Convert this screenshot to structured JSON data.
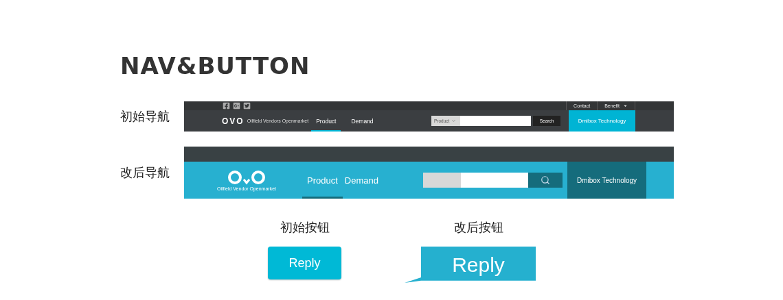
{
  "title": "NAV&BUTTON",
  "navs": [
    {
      "kind": "original",
      "label": "初始导航",
      "top_links": [
        {
          "label": "Contact",
          "dropdown": false
        },
        {
          "label": "Benefit",
          "dropdown": true
        }
      ],
      "logo": "OVO",
      "tagline": "Oilfield Vendors Openmarket",
      "items": [
        {
          "label": "Product",
          "selected": true
        },
        {
          "label": "Demand",
          "selected": false
        }
      ],
      "search": {
        "category": "Product",
        "button": "Search"
      },
      "account": "Dmibox Technology"
    },
    {
      "kind": "revised",
      "label": "改后导航",
      "tagline": "Oilfield Vendor Openmarket",
      "items": [
        {
          "label": "Product",
          "selected": true
        },
        {
          "label": "Demand",
          "selected": false
        }
      ],
      "account": "Dmibox Technology"
    }
  ],
  "buttons": [
    {
      "kind": "original",
      "caption": "初始按钮",
      "label": "Reply"
    },
    {
      "kind": "revised",
      "caption": "改后按钮",
      "label": "Reply"
    }
  ]
}
